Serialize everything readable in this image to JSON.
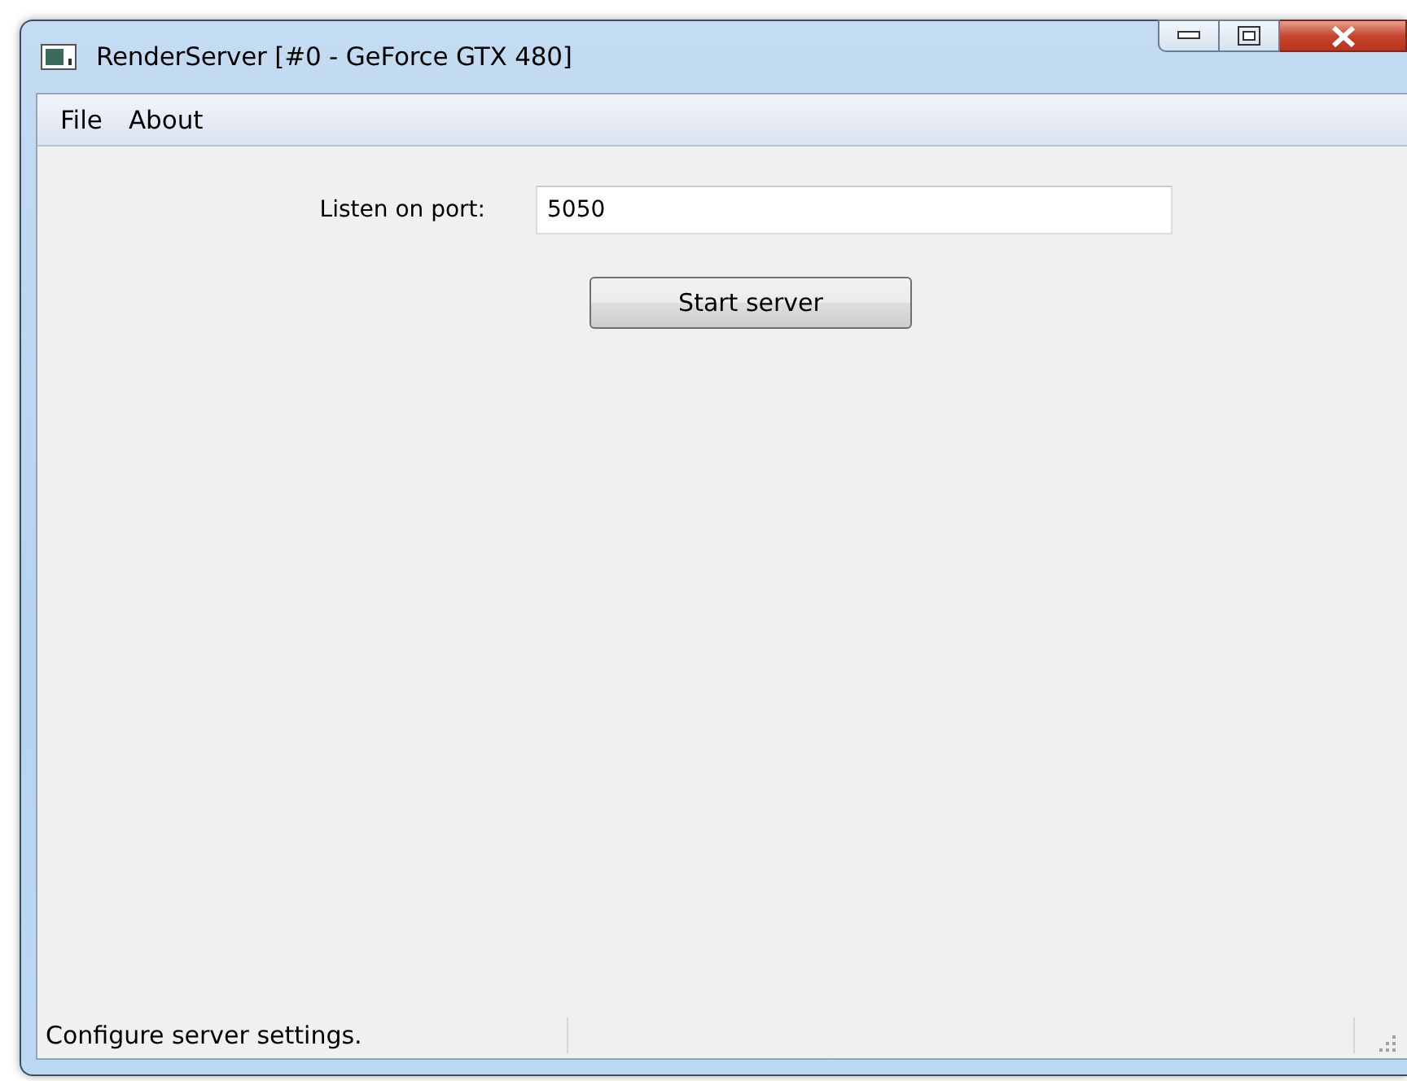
{
  "window": {
    "title": "RenderServer [#0 - GeForce GTX 480]"
  },
  "menu": [
    "File",
    "About"
  ],
  "form": {
    "label": "Listen on port:",
    "port": "5050",
    "button": "Start server"
  },
  "status_bar": {
    "message": "Configure server settings."
  }
}
